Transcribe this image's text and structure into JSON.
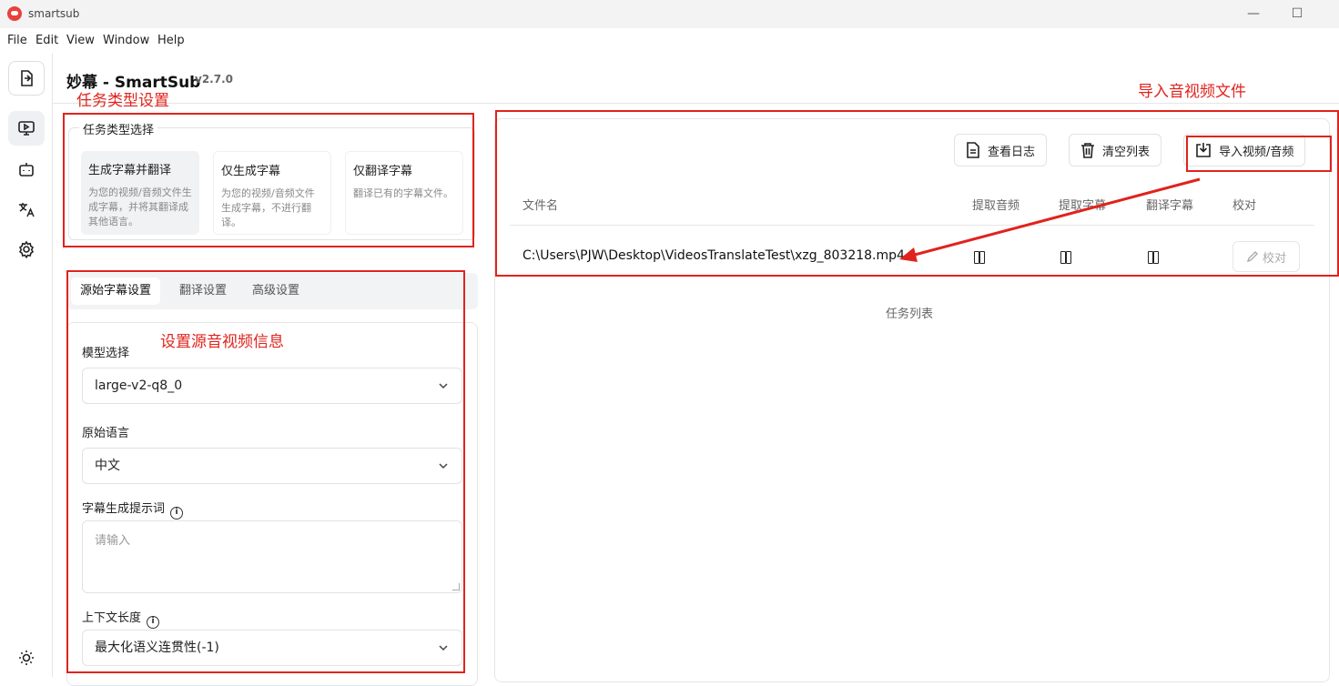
{
  "window": {
    "title": "smartsub",
    "minimize": "—",
    "maximize": "☐",
    "close": "✕"
  },
  "menu": [
    "File",
    "Edit",
    "View",
    "Window",
    "Help"
  ],
  "app": {
    "title": "妙幕 - SmartSub",
    "version": "v2.7.0"
  },
  "annotations": {
    "task_type": "任务类型设置",
    "import": "导入音视频文件",
    "source": "设置源音视频信息"
  },
  "task_type": {
    "legend": "任务类型选择",
    "options": [
      {
        "title": "生成字幕并翻译",
        "desc": "为您的视频/音频文件生成字幕，并将其翻译成其他语言。"
      },
      {
        "title": "仅生成字幕",
        "desc": "为您的视频/音频文件生成字幕，不进行翻译。"
      },
      {
        "title": "仅翻译字幕",
        "desc": "翻译已有的字幕文件。"
      }
    ]
  },
  "tabs": [
    "源始字幕设置",
    "翻译设置",
    "高级设置"
  ],
  "form": {
    "model_label": "模型选择",
    "model_value": "large-v2-q8_0",
    "lang_label": "原始语言",
    "lang_value": "中文",
    "prompt_label": "字幕生成提示词",
    "prompt_placeholder": "请输入",
    "context_label": "上下文长度",
    "context_value": "最大化语义连贯性(-1)"
  },
  "toolbar": {
    "log": "查看日志",
    "clear": "清空列表",
    "import": "导入视频/音频"
  },
  "table": {
    "headers": [
      "文件名",
      "提取音频",
      "提取字幕",
      "翻译字幕",
      "校对"
    ],
    "rows": [
      {
        "file": "C:\\Users\\PJW\\Desktop\\VideosTranslateTest\\xzg_803218.mp4",
        "check": "校对"
      }
    ],
    "caption": "任务列表"
  }
}
